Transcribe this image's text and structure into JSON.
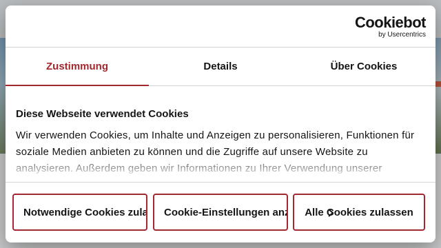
{
  "brand": {
    "name": "Cookiebot",
    "sub": "by Usercentrics"
  },
  "tabs": [
    {
      "label": "Zustimmung",
      "active": true
    },
    {
      "label": "Details",
      "active": false
    },
    {
      "label": "Über Cookies",
      "active": false
    }
  ],
  "content": {
    "title": "Diese Webseite verwendet Cookies",
    "text": "Wir verwenden Cookies, um Inhalte und Anzeigen zu personalisieren, Funktionen für soziale Medien anbieten zu können und die Zugriffe auf unsere Website zu analysieren. Außerdem geben wir Informationen zu Ihrer Verwendung unserer"
  },
  "buttons": {
    "necessary": "Notwendige Cookies zulassen",
    "settings": "Cookie-Einstellungen anzeigen",
    "allow_all": "Alle Cookies zulassen"
  },
  "colors": {
    "accent": "#a3272e",
    "text": "#141414"
  }
}
